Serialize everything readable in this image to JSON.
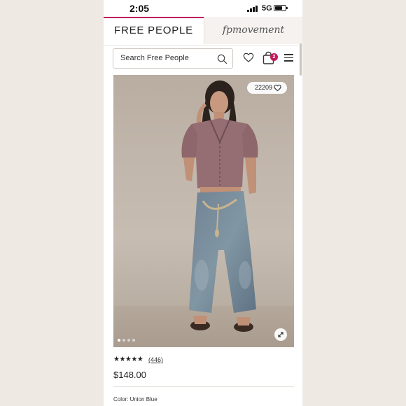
{
  "status_bar": {
    "time": "2:05",
    "network": "5G",
    "battery_level": 0.7
  },
  "brand_tabs": {
    "primary": "FREE PEOPLE",
    "secondary": "fpmovement"
  },
  "header": {
    "search_placeholder": "Search Free People",
    "icons": [
      "search-icon",
      "heart-icon",
      "shopping-bag-icon",
      "hamburger-menu-icon"
    ],
    "bag_count": "2"
  },
  "product": {
    "favorites_count": "22209",
    "image_dots": {
      "count": 4,
      "active": 0
    },
    "rating_stars": "★★★★★",
    "rating_value": 4.5,
    "reviews": "(446)",
    "price": "$148.00",
    "color_label": "Color: Union Blue"
  },
  "colors": {
    "accent": "#c2185b",
    "page_background": "#efe9e4",
    "phone_background": "#ffffff"
  }
}
